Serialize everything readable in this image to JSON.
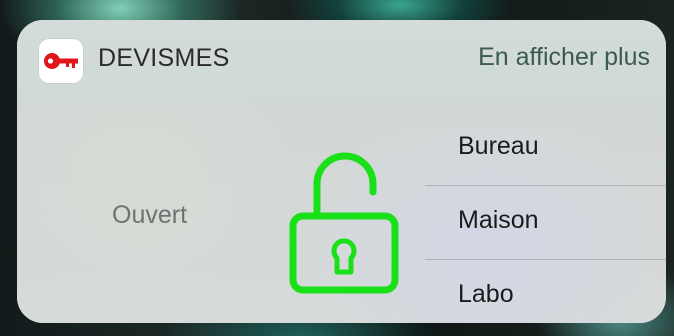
{
  "app": {
    "name": "DEVISMES",
    "icon": "key-icon",
    "icon_color": "#e0161c"
  },
  "header": {
    "show_more_label": "En afficher plus"
  },
  "status": {
    "label": "Ouvert",
    "icon": "unlocked-padlock-icon",
    "icon_color": "#19e019"
  },
  "doors": [
    {
      "label": "Bureau"
    },
    {
      "label": "Maison"
    },
    {
      "label": "Labo"
    }
  ]
}
